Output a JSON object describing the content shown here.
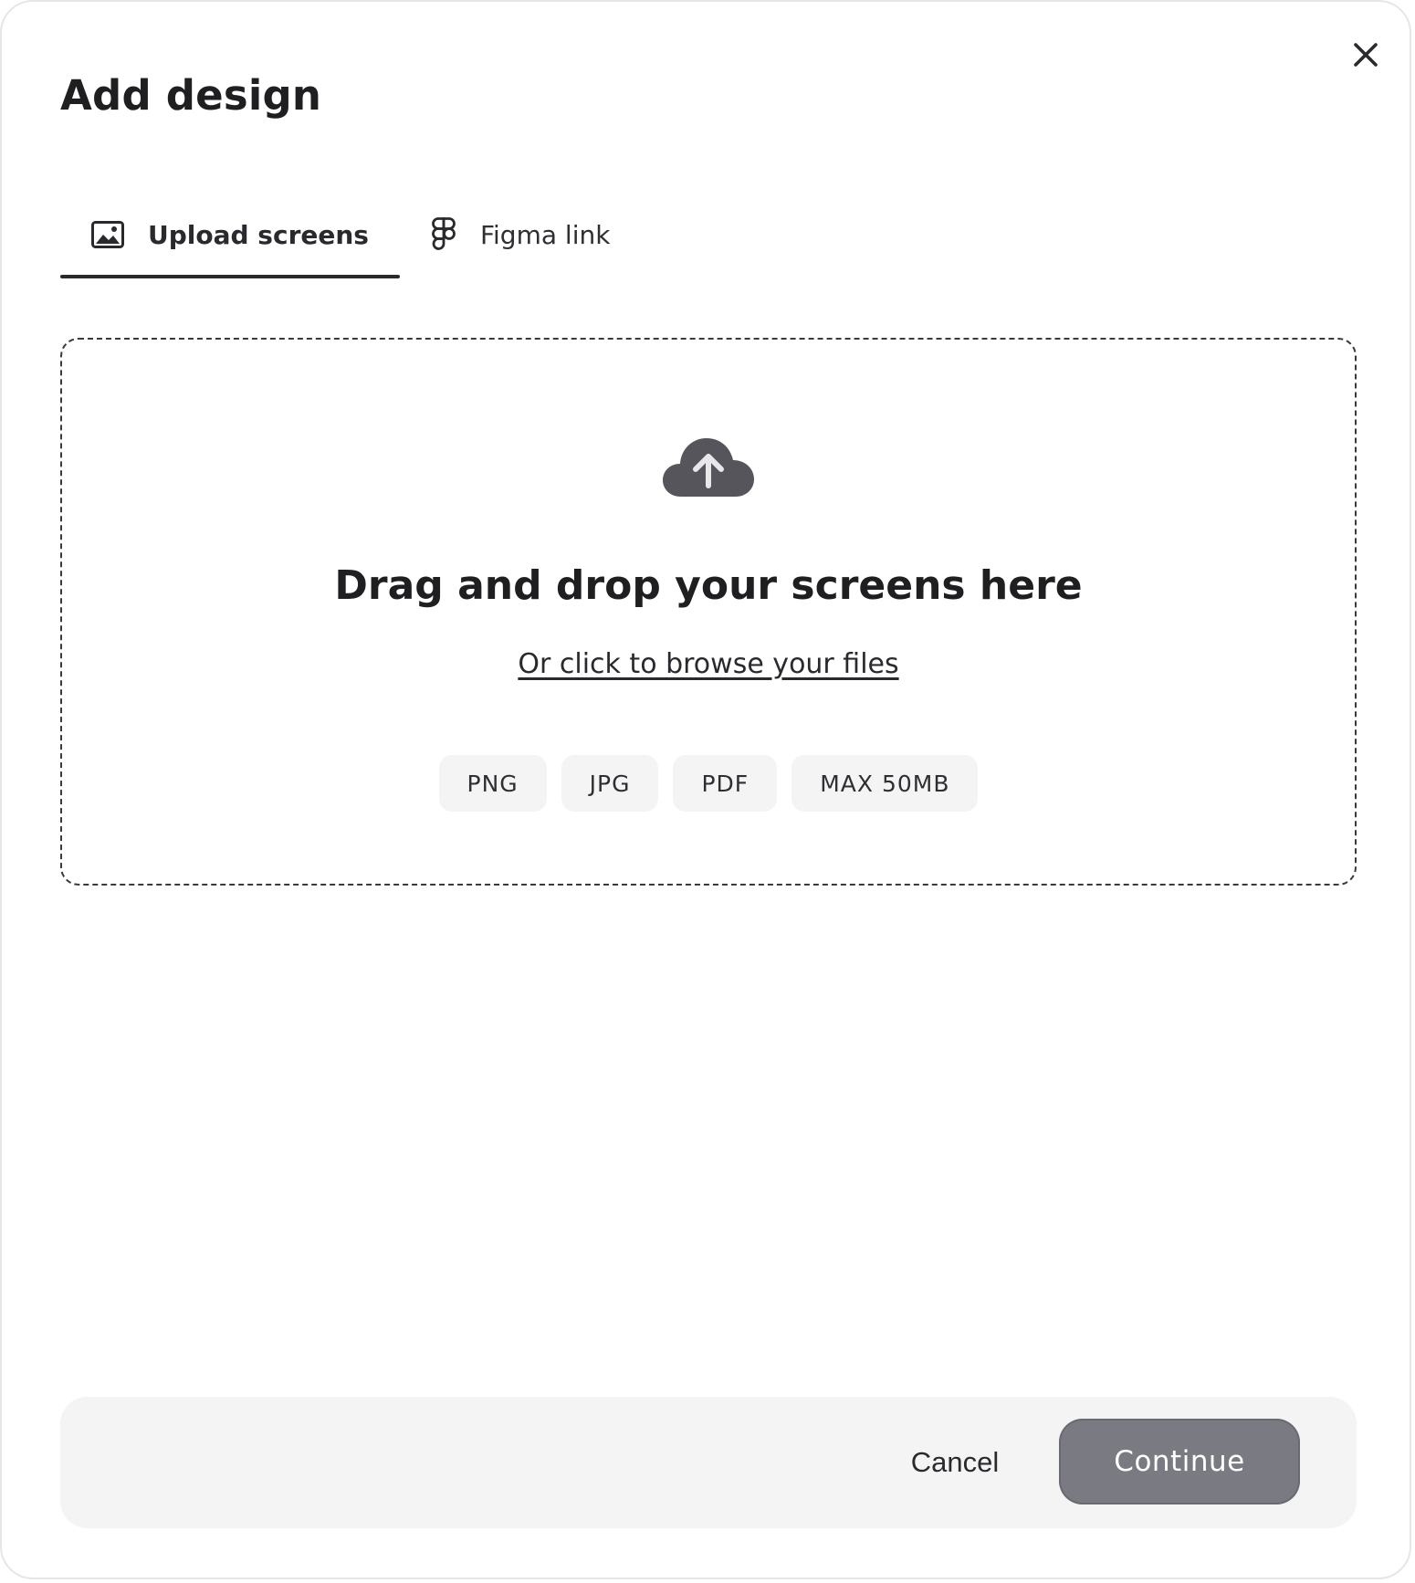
{
  "dialog": {
    "title": "Add design",
    "close_icon": "close-icon"
  },
  "tabs": [
    {
      "label": "Upload screens",
      "icon": "image-icon",
      "active": true
    },
    {
      "label": "Figma link",
      "icon": "figma-icon",
      "active": false
    }
  ],
  "dropzone": {
    "icon": "cloud-upload-icon",
    "heading": "Drag and drop your screens here",
    "browse_link": "Or click to browse your files",
    "chips": [
      "PNG",
      "JPG",
      "PDF",
      "MAX 50MB"
    ]
  },
  "footer": {
    "cancel_label": "Cancel",
    "continue_label": "Continue",
    "continue_color": "#7a7a82"
  }
}
